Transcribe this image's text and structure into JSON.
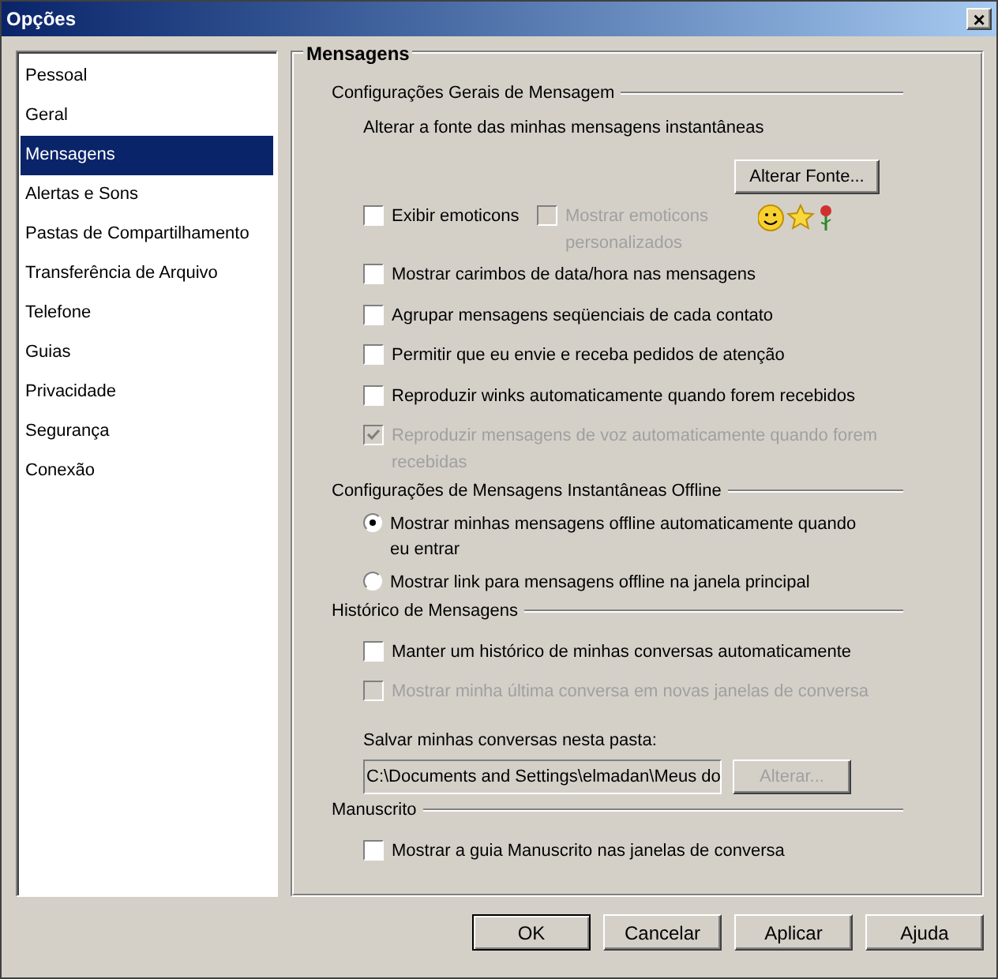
{
  "window": {
    "title": "Opções",
    "close": "×"
  },
  "sidebar": {
    "items": [
      {
        "label": "Pessoal",
        "selected": false
      },
      {
        "label": "Geral",
        "selected": false
      },
      {
        "label": "Mensagens",
        "selected": true
      },
      {
        "label": "Alertas e Sons",
        "selected": false
      },
      {
        "label": "Pastas de Compartilhamento",
        "selected": false
      },
      {
        "label": "Transferência de Arquivo",
        "selected": false
      },
      {
        "label": "Telefone",
        "selected": false
      },
      {
        "label": "Guias",
        "selected": false
      },
      {
        "label": "Privacidade",
        "selected": false
      },
      {
        "label": "Segurança",
        "selected": false
      },
      {
        "label": "Conexão",
        "selected": false
      }
    ]
  },
  "panel": {
    "title": "Mensagens",
    "sections": [
      {
        "title": "Configurações Gerais de Mensagem",
        "items": [
          {
            "kind": "text",
            "label": "Alterar a fonte das minhas mensagens instantâneas"
          },
          {
            "kind": "button",
            "label": "Alterar Fonte...",
            "disabled": false
          },
          {
            "kind": "emoticons",
            "options": [
              {
                "label": "Exibir emoticons",
                "checked": false,
                "disabled": false
              },
              {
                "label": "Mostrar emoticons personalizados",
                "checked": false,
                "disabled": true
              }
            ]
          },
          {
            "kind": "checkbox",
            "label": "Mostrar carimbos de data/hora nas mensagens",
            "checked": false,
            "disabled": false
          },
          {
            "kind": "checkbox",
            "label": "Agrupar mensagens seqüenciais de cada contato",
            "checked": false,
            "disabled": false
          },
          {
            "kind": "checkbox",
            "label": "Permitir que eu envie e receba pedidos de atenção",
            "checked": false,
            "disabled": false
          },
          {
            "kind": "checkbox",
            "label": "Reproduzir winks automaticamente quando forem recebidos",
            "checked": false,
            "disabled": false
          },
          {
            "kind": "checkbox",
            "label": "Reproduzir mensagens de voz automaticamente quando forem recebidas",
            "checked": true,
            "disabled": true
          }
        ]
      },
      {
        "title": "Configurações de Mensagens Instantâneas Offline",
        "items": [
          {
            "kind": "radio",
            "label": "Mostrar minhas mensagens offline automaticamente quando eu entrar",
            "selected": true
          },
          {
            "kind": "radio",
            "label": "Mostrar link para mensagens offline na janela principal",
            "selected": false
          }
        ]
      },
      {
        "title": "Histórico de Mensagens",
        "items": [
          {
            "kind": "checkbox",
            "label": "Manter um histórico de minhas conversas automaticamente",
            "checked": false,
            "disabled": false
          },
          {
            "kind": "checkbox",
            "label": "Mostrar minha última conversa em novas janelas de conversa",
            "checked": false,
            "disabled": true
          },
          {
            "kind": "folder",
            "label": "Salvar minhas conversas nesta pasta:",
            "value": "C:\\Documents and Settings\\elmadan\\Meus do",
            "button": {
              "label": "Alterar...",
              "disabled": true
            }
          }
        ]
      },
      {
        "title": "Manuscrito",
        "items": [
          {
            "kind": "checkbox",
            "label": "Mostrar a guia Manuscrito nas janelas de conversa",
            "checked": false,
            "disabled": false
          }
        ]
      }
    ]
  },
  "buttons": [
    {
      "label": "OK",
      "default": true
    },
    {
      "label": "Cancelar",
      "default": false
    },
    {
      "label": "Aplicar",
      "default": false
    },
    {
      "label": "Ajuda",
      "default": false
    }
  ]
}
